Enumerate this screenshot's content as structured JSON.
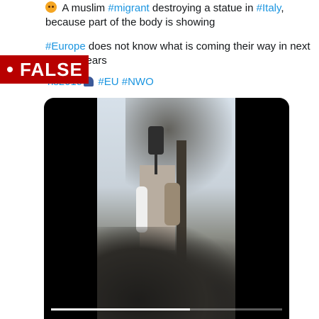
{
  "tweet": {
    "line1_after_emoji": " A muslim ",
    "hashtag_migrant": "#migrant",
    "line1_mid": " destroying a statue in ",
    "hashtag_italy": "#Italy",
    "line1_end": ",",
    "line2": "because part of the body is showing",
    "hashtag_europe": "#Europe",
    "line3_rest": " does not know what is coming their way in next",
    "line4": "5 to 10 years",
    "hashtag_elections_tail": "ns2019",
    "hashtag_eu": "#EU",
    "hashtag_nwo": "#NWO"
  },
  "label": {
    "text": "FALSE",
    "color": "#b80000"
  },
  "video": {
    "progress_fraction": 0.6
  },
  "colors": {
    "hashtag": "#1b95e0",
    "text": "#14171a"
  },
  "icons": [
    "angry-face-emoji-icon",
    "ballot-box-emoji-icon"
  ]
}
